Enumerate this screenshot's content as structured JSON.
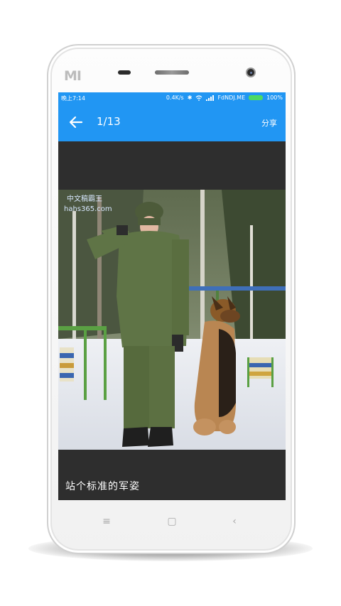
{
  "device": {
    "brand": "MI"
  },
  "status_bar": {
    "time": "晚上7:14",
    "net_speed": "0.4K/s",
    "carrier": "FdNDJ.ME",
    "battery_percent": "100%"
  },
  "toolbar": {
    "counter": "1/13",
    "share_label": "分享"
  },
  "photo": {
    "watermark_line1": "中文稿霸王",
    "watermark_line2": "hahs365.com"
  },
  "caption": "站个标准的军姿",
  "colors": {
    "accent": "#2196f3",
    "viewer_bg": "#2e2e2e",
    "battery": "#4cd964"
  },
  "icons": [
    "back-arrow-icon",
    "bluetooth-icon",
    "wifi-icon",
    "signal-icon",
    "battery-icon",
    "menu-icon",
    "home-icon",
    "back-nav-icon"
  ]
}
